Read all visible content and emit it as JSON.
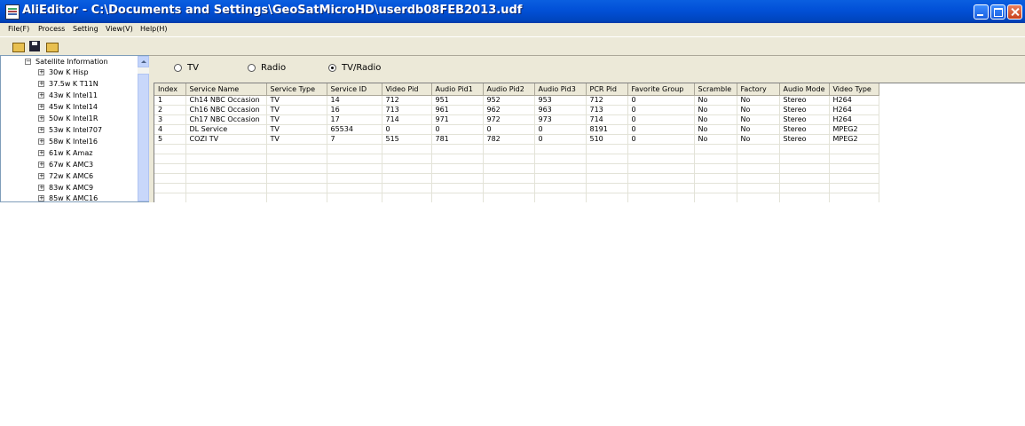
{
  "window": {
    "title": "AliEditor - C:\\Documents and Settings\\GeoSatMicroHD\\userdb08FEB2013.udf"
  },
  "menu": [
    "File(F)",
    "Process",
    "Setting",
    "View(V)",
    "Help(H)"
  ],
  "toolbar": {
    "icons": [
      "open-folder-icon",
      "save-icon",
      "open-file-icon"
    ]
  },
  "tree": {
    "root": "Satellite Information",
    "items": [
      "30w K Hisp",
      "37.5w K T11N",
      "43w K Intel11",
      "45w K Intel14",
      "50w K Intel1R",
      "53w K Intel707",
      "58w K Intel16",
      "61w K Amaz",
      "67w K AMC3",
      "72w K AMC6",
      "83w K AMC9",
      "85w K AMC16"
    ]
  },
  "filters": {
    "tv": "TV",
    "radio": "Radio",
    "tvradio": "TV/Radio",
    "selected": "tvradio"
  },
  "table": {
    "columns": [
      "Index",
      "Service Name",
      "Service Type",
      "Service ID",
      "Video Pid",
      "Audio Pid1",
      "Audio Pid2",
      "Audio Pid3",
      "PCR Pid",
      "Favorite Group",
      "Scramble",
      "Factory",
      "Audio Mode",
      "Video Type"
    ],
    "rows": [
      [
        "1",
        "Ch14 NBC Occasion",
        "TV",
        "14",
        "712",
        "951",
        "952",
        "953",
        "712",
        "0",
        "No",
        "No",
        "Stereo",
        "H264"
      ],
      [
        "2",
        "Ch16 NBC Occasion",
        "TV",
        "16",
        "713",
        "961",
        "962",
        "963",
        "713",
        "0",
        "No",
        "No",
        "Stereo",
        "H264"
      ],
      [
        "3",
        "Ch17 NBC Occasion",
        "TV",
        "17",
        "714",
        "971",
        "972",
        "973",
        "714",
        "0",
        "No",
        "No",
        "Stereo",
        "H264"
      ],
      [
        "4",
        "DL Service",
        "TV",
        "65534",
        "0",
        "0",
        "0",
        "0",
        "8191",
        "0",
        "No",
        "No",
        "Stereo",
        "MPEG2"
      ],
      [
        "5",
        "COZI TV",
        "TV",
        "7",
        "515",
        "781",
        "782",
        "0",
        "510",
        "0",
        "No",
        "No",
        "Stereo",
        "MPEG2"
      ]
    ]
  }
}
